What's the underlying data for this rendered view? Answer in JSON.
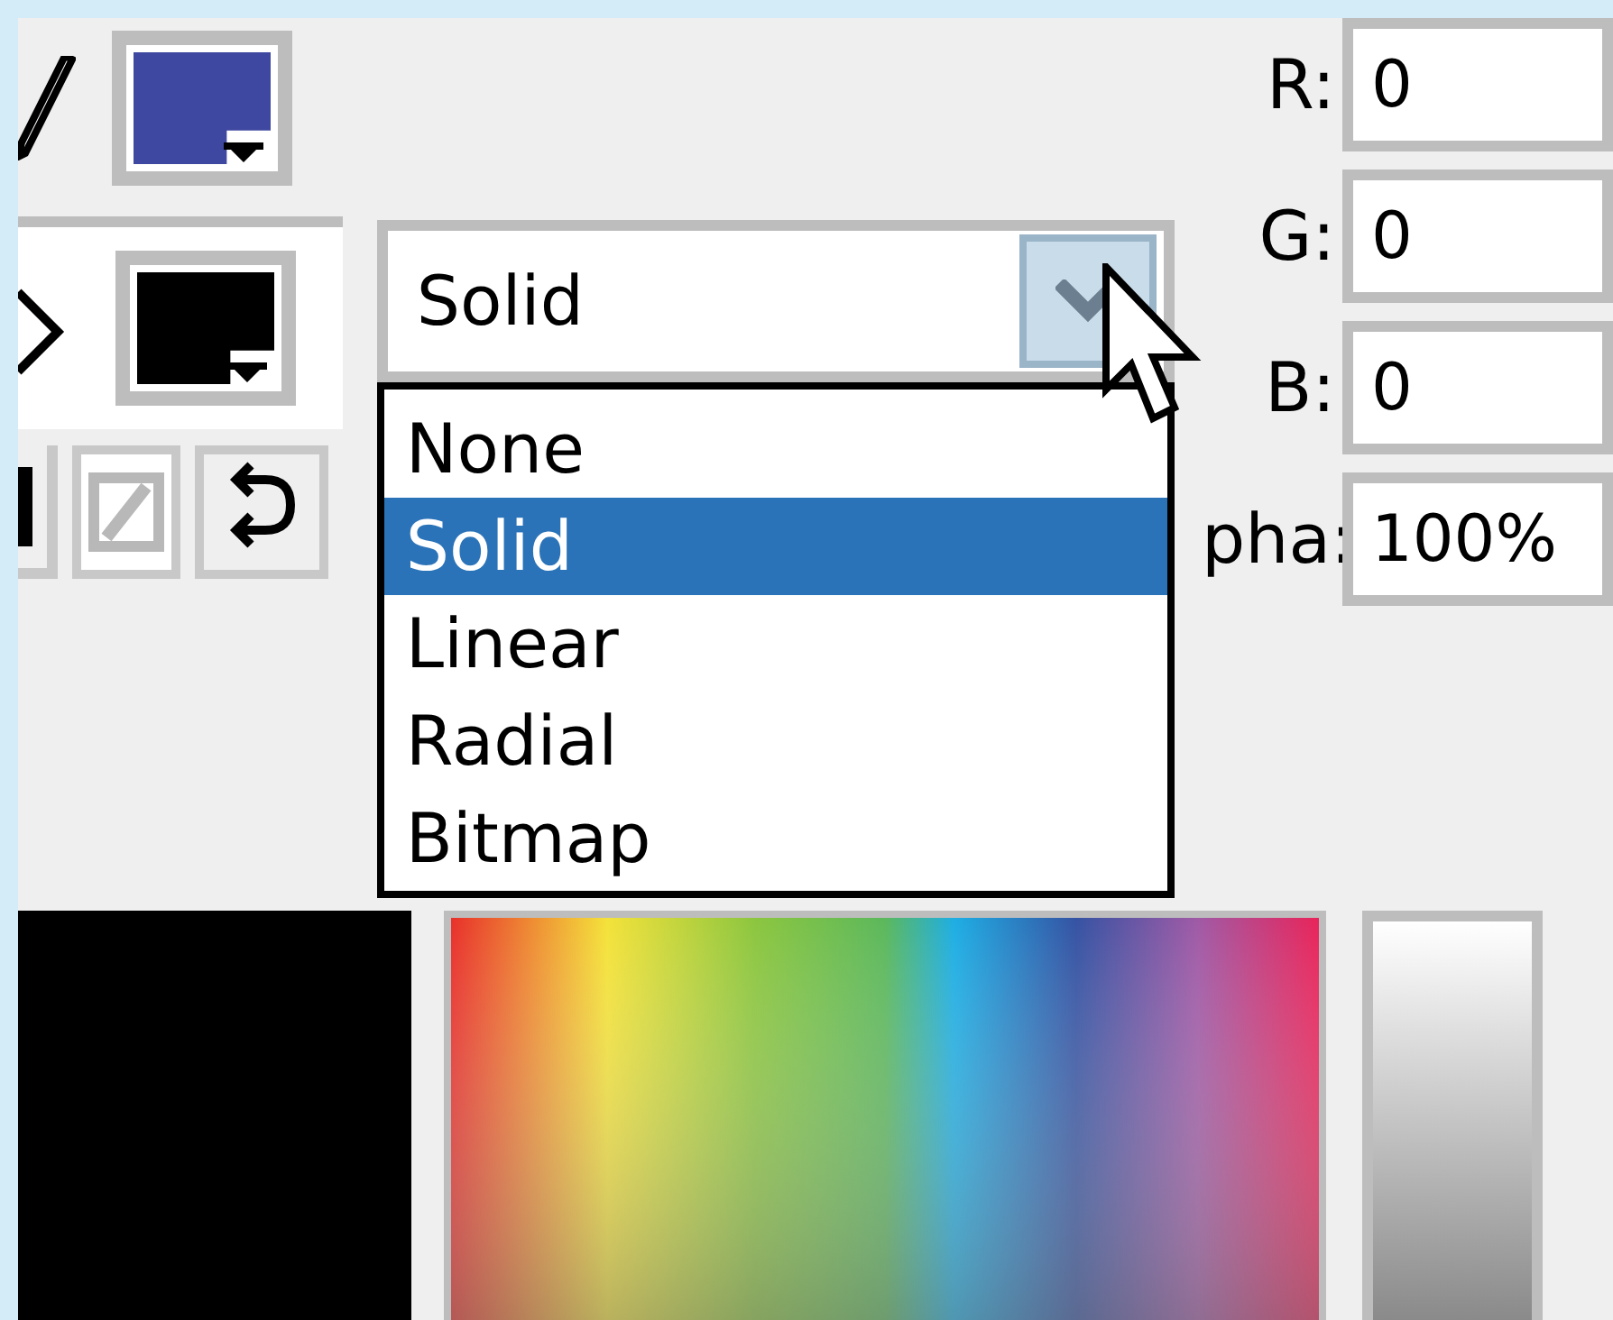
{
  "stroke_swatch": {
    "color": "#3f48a0"
  },
  "fill_swatch": {
    "color": "#000000"
  },
  "fill_type": {
    "value": "Solid",
    "expanded": true,
    "options": [
      {
        "label": "None",
        "selected": false
      },
      {
        "label": "Solid",
        "selected": true
      },
      {
        "label": "Linear",
        "selected": false
      },
      {
        "label": "Radial",
        "selected": false
      },
      {
        "label": "Bitmap",
        "selected": false
      }
    ]
  },
  "channels": [
    {
      "label": "R:",
      "value": "0"
    },
    {
      "label": "G:",
      "value": "0"
    },
    {
      "label": "B:",
      "value": "0"
    },
    {
      "label": "pha:",
      "value": "100%"
    }
  ],
  "current_color": {
    "color": "#000000"
  }
}
